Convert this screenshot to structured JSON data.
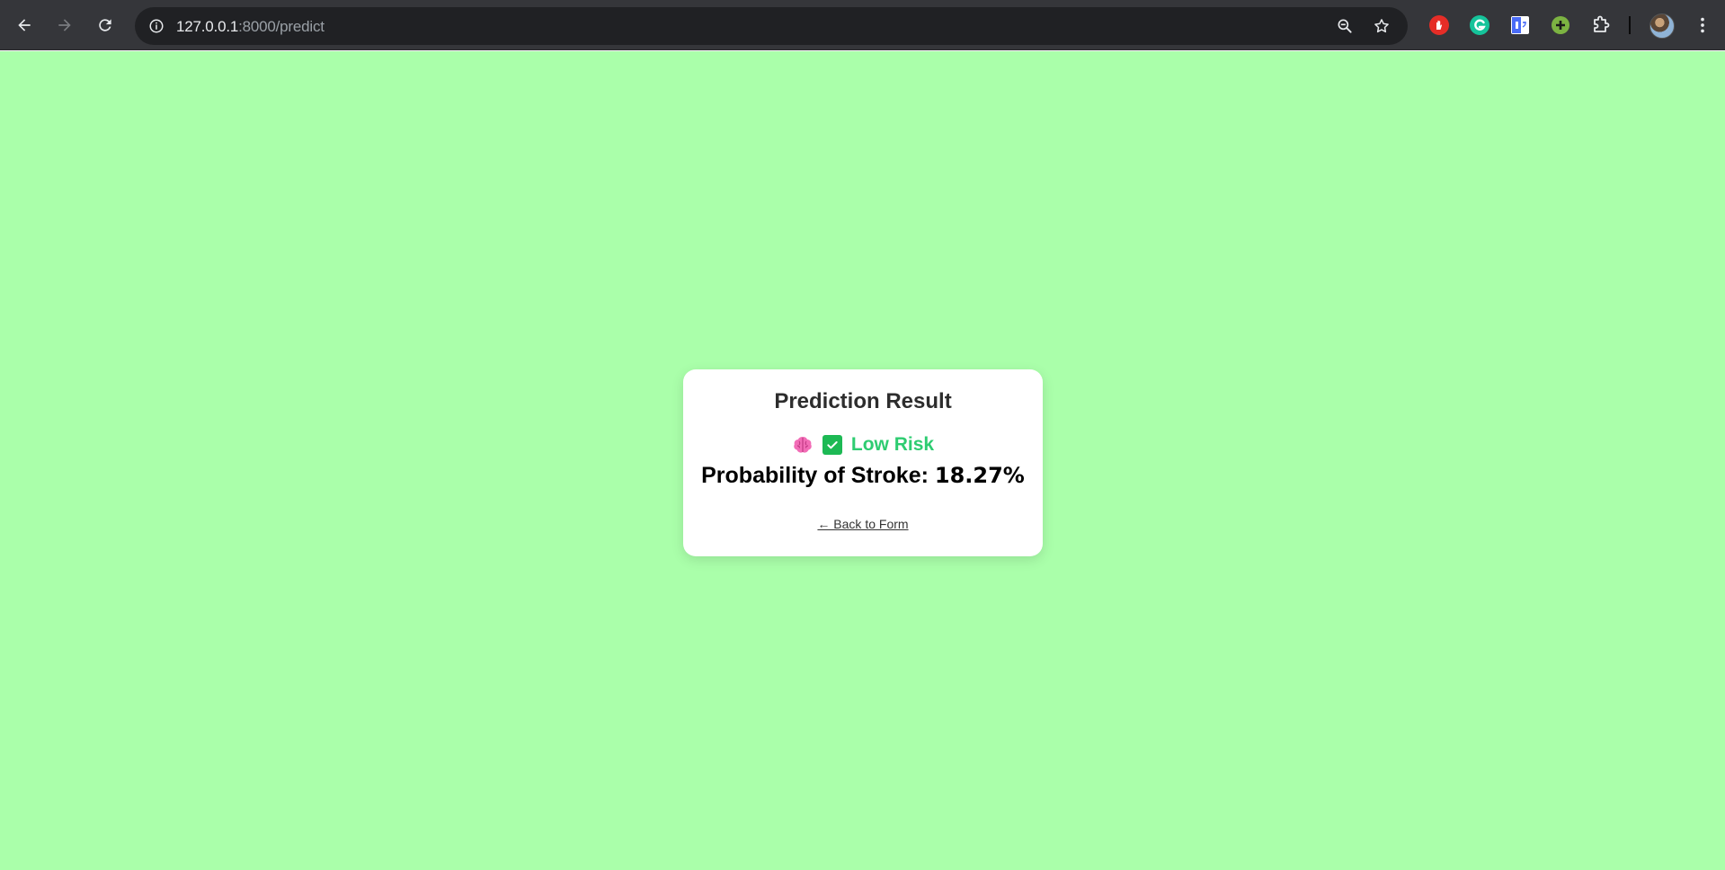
{
  "browser": {
    "url_host": "127.0.0.1",
    "url_path": ":8000/predict",
    "icons": {
      "back": "arrow-left-icon",
      "forward": "arrow-right-icon",
      "reload": "reload-icon",
      "site_info": "info-icon",
      "zoom": "zoom-out-icon",
      "bookmark": "star-icon",
      "extensions": "puzzle-icon",
      "menu": "kebab-menu-icon"
    },
    "extension_colors": {
      "hand": "#e52d27",
      "grammarly": "#15c39a",
      "translate": "#4a6cf7",
      "plus": "#7cb342"
    }
  },
  "page": {
    "background": "#aaffaa",
    "title": "Prediction Result",
    "result": {
      "brain_icon": "brain-icon",
      "check_icon": "check-box-icon",
      "label": "Low Risk",
      "label_color": "#2ecc71"
    },
    "probability_label": "Probability of Stroke: ",
    "probability_value": "18.27%",
    "back_link": "← Back to Form"
  }
}
